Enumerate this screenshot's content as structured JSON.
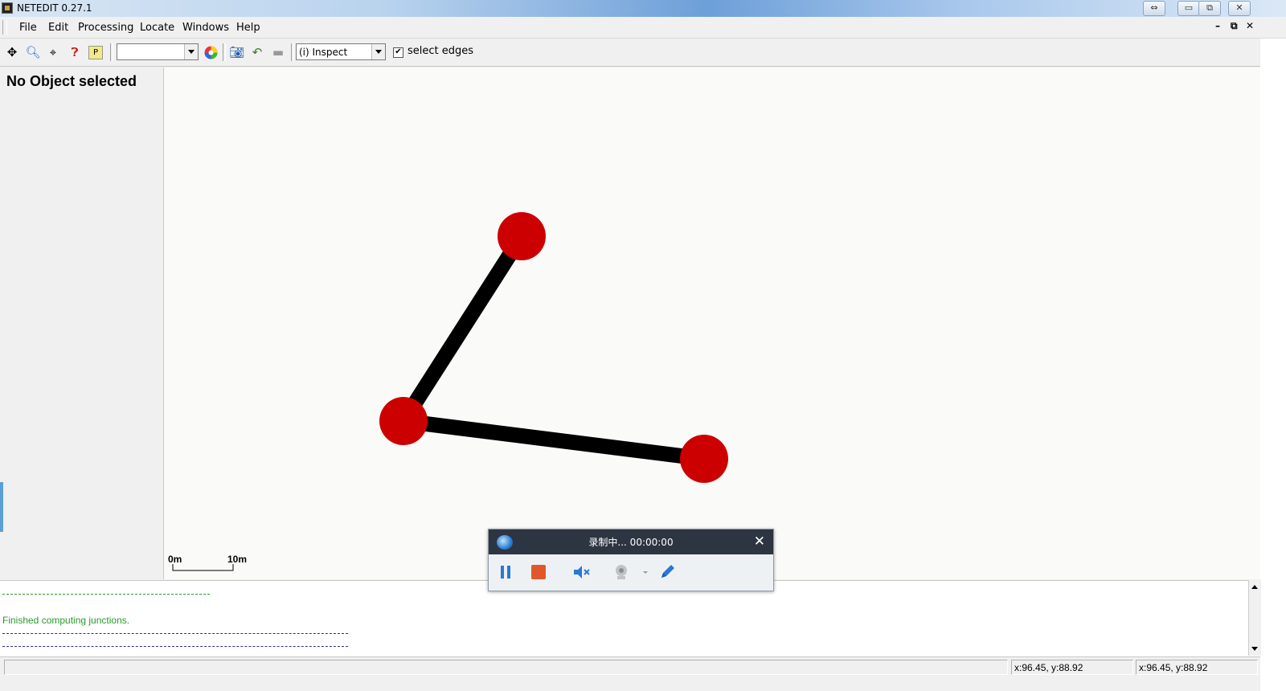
{
  "window": {
    "title": "NETEDIT 0.27.1"
  },
  "menu": [
    {
      "label": "File"
    },
    {
      "label": "Edit"
    },
    {
      "label": "Processing"
    },
    {
      "label": "Locate"
    },
    {
      "label": "Windows"
    },
    {
      "label": "Help"
    }
  ],
  "toolbar": {
    "scheme_combo_value": "",
    "mode_combo_value": "(i) Inspect",
    "select_edges_label": "select edges",
    "select_edges_checked": true,
    "check_mark": "✔"
  },
  "left_panel": {
    "title": "No Object selected"
  },
  "canvas": {
    "scale_start": "0m",
    "scale_end": "10m",
    "junction_color": "#cc0000",
    "edge_color": "#000000"
  },
  "messages": {
    "finished": "Finished computing junctions."
  },
  "status": {
    "cursor_pos_1": "x:96.45, y:88.92",
    "cursor_pos_2": "x:96.45, y:88.92"
  },
  "recorder": {
    "title": "录制中... 00:00:00",
    "close": "✕"
  }
}
